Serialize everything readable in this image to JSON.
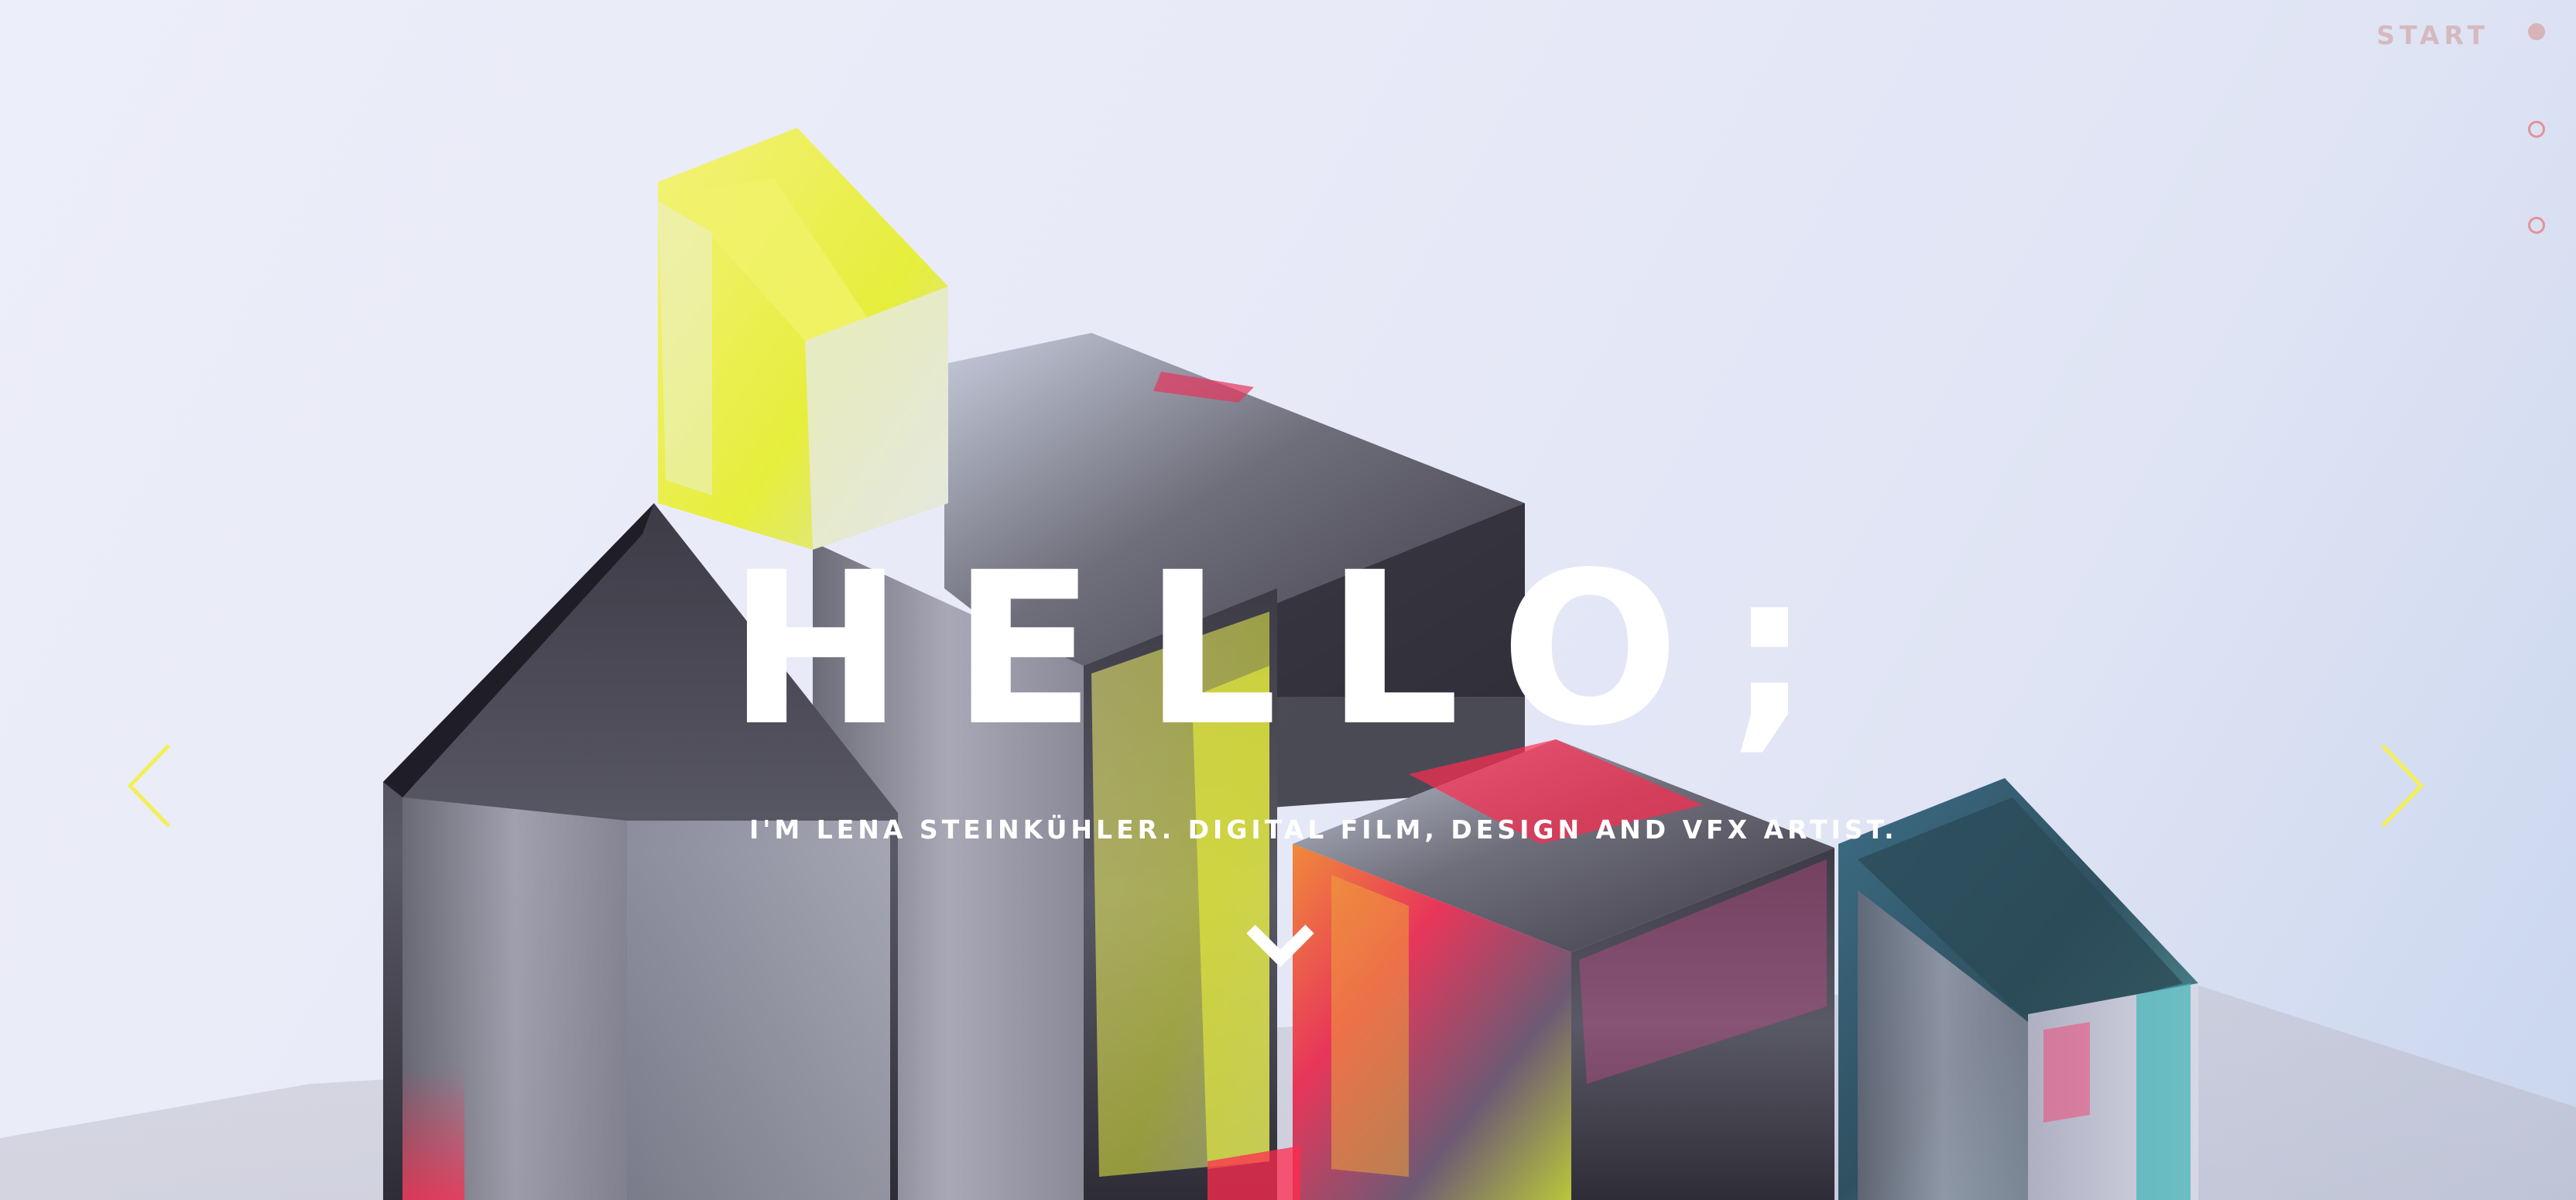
{
  "hero": {
    "title": "HELLO;",
    "subtitle": "I'M LENA STEINKÜHLER. DIGITAL FILM, DESIGN AND VFX ARTIST."
  },
  "nav": {
    "active_label": "START",
    "sections": [
      "START",
      "",
      ""
    ]
  },
  "icons": {
    "prev": "chevron-left-icon",
    "next": "chevron-right-icon",
    "scroll": "chevron-down-icon"
  },
  "colors": {
    "accent_arrows": "#f2f055",
    "nav_dot_active": "#d8b4b8",
    "nav_dot_inactive": "#e6919b",
    "title_text": "#ffffff"
  }
}
